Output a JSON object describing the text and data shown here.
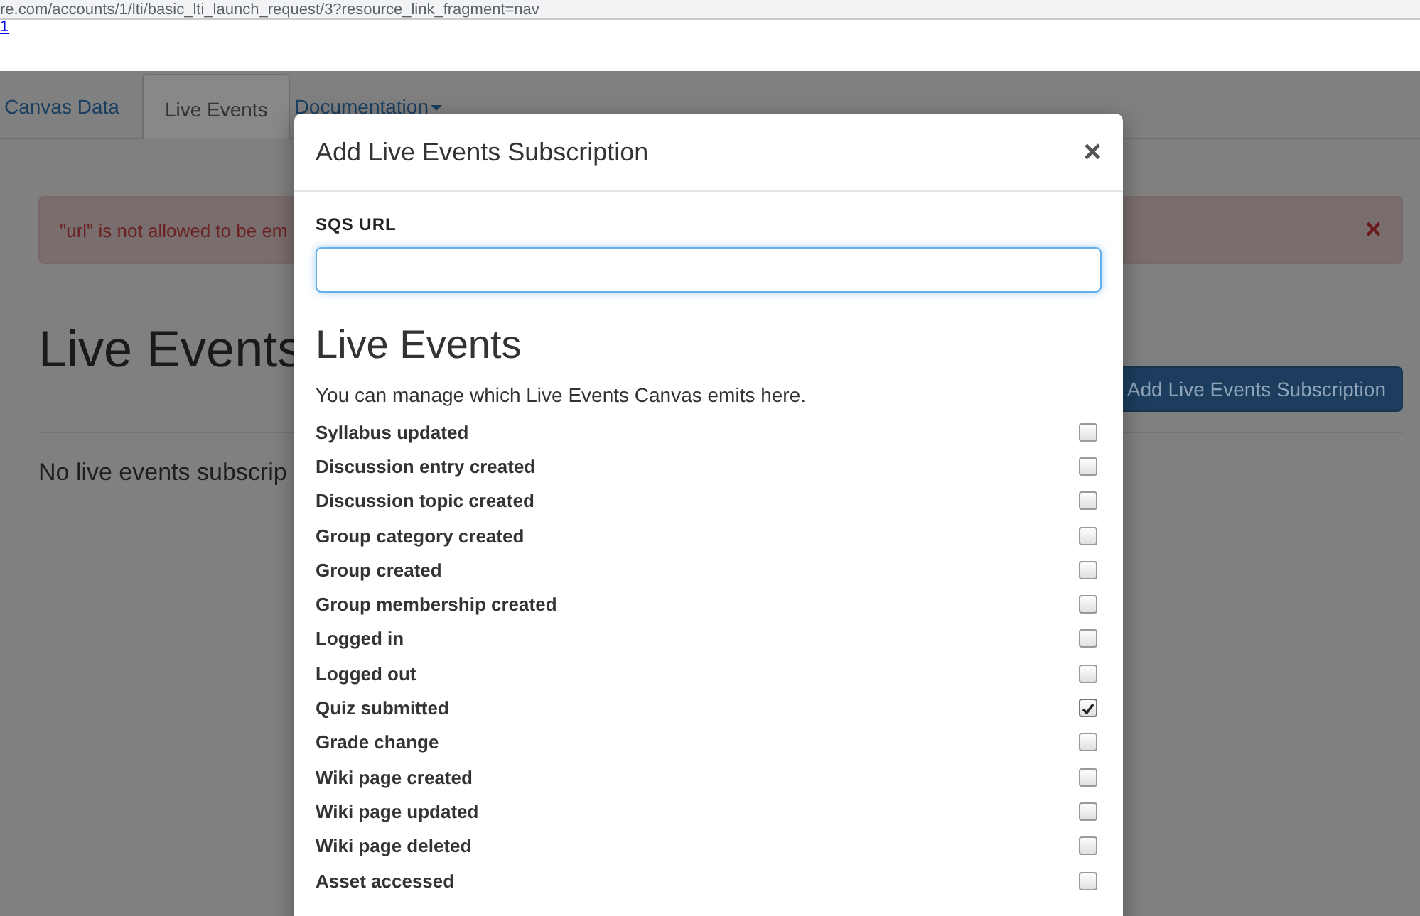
{
  "browser": {
    "url": "re.com/accounts/1/lti/basic_lti_launch_request/3?resource_link_fragment=nav",
    "link": "1"
  },
  "tabs": [
    {
      "label": "Canvas Data",
      "selected": false,
      "dropdown": false
    },
    {
      "label": "Live Events",
      "selected": true,
      "dropdown": false
    },
    {
      "label": "Documentation",
      "selected": false,
      "dropdown": true
    }
  ],
  "alert": {
    "message": "\"url\" is not allowed to be em",
    "close": "×"
  },
  "page": {
    "heading": "Live Events",
    "button": "Add Live Events Subscription",
    "empty_message": "No live events subscrip"
  },
  "modal": {
    "title": "Add Live Events Subscription",
    "close": "×",
    "field_label": "SQS URL",
    "section_heading": "Live Events",
    "description": "You can manage which Live Events Canvas emits here.",
    "events": [
      {
        "label": "Syllabus updated",
        "checked": false
      },
      {
        "label": "Discussion entry created",
        "checked": false
      },
      {
        "label": "Discussion topic created",
        "checked": false
      },
      {
        "label": "Group category created",
        "checked": false
      },
      {
        "label": "Group created",
        "checked": false
      },
      {
        "label": "Group membership created",
        "checked": false
      },
      {
        "label": "Logged in",
        "checked": false
      },
      {
        "label": "Logged out",
        "checked": false
      },
      {
        "label": "Quiz submitted",
        "checked": true
      },
      {
        "label": "Grade change",
        "checked": false
      },
      {
        "label": "Wiki page created",
        "checked": false
      },
      {
        "label": "Wiki page updated",
        "checked": false
      },
      {
        "label": "Wiki page deleted",
        "checked": false
      },
      {
        "label": "Asset accessed",
        "checked": false
      }
    ]
  }
}
